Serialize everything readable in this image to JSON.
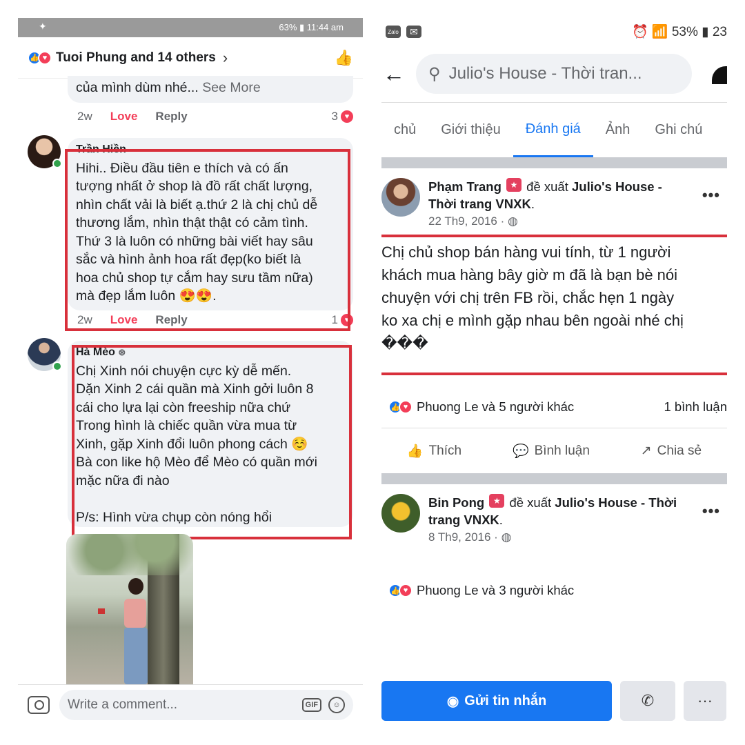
{
  "left": {
    "status": {
      "text": "63% ▮ 11:44 am"
    },
    "header": {
      "title": "Tuoi Phung and 14 others"
    },
    "first_comment": {
      "tail": "của mình dùm nhé...",
      "see_more": "See More",
      "time": "2w",
      "love": "Love",
      "reply": "Reply",
      "count": "3"
    },
    "comment1": {
      "author": "Trần Hiền",
      "lines": [
        "Hihi.. Điều đầu tiên e thích và có ấn",
        "tượng nhất  ở shop là đồ rất  chất lượng,",
        "nhìn chất vải là biết  ạ.thứ  2 là chị chủ dễ",
        "thương lắm, nhìn  thật thật có cảm tình.",
        "Thứ  3 là luôn có những  bài viết hay sâu",
        "sắc và hình ảnh hoa rất đẹp(ko biết  là",
        "hoa chủ shop tự cắm hay sưu tầm nữa)",
        "mà đẹp lắm  luôn 😍😍."
      ],
      "time": "2w",
      "love": "Love",
      "reply": "Reply",
      "count": "1"
    },
    "comment2": {
      "author": "Hà Mèo",
      "lines": [
        "Chị Xinh nói chuyện cực kỳ dễ mến.",
        "Dặn Xinh 2 cái quần mà Xinh gởi luôn 8",
        "cái cho lựa lại còn freeship nữa chứ",
        "Trong hình là chiếc quần vừa mua từ",
        "Xinh, gặp Xinh đổi luôn phong cách ☺️",
        "Bà con like hộ Mèo để Mèo có quần mới",
        "mặc nữa đi nào",
        "",
        "P/s: Hình vừa chụp còn nóng hổi"
      ]
    },
    "comment_input": {
      "placeholder": "Write a comment...",
      "gif": "GIF"
    }
  },
  "right": {
    "status": {
      "text": "⏰ 📶 53% ▮ 23"
    },
    "search": {
      "query": "Julio's House - Thời tran..."
    },
    "tabs": [
      "chủ",
      "Giới thiệu",
      "Đánh giá",
      "Ảnh",
      "Ghi chú"
    ],
    "active_tab": 2,
    "post1": {
      "author": "Phạm Trang",
      "verb": "đề xuất",
      "page": "Julio's House - Thời trang VNXK",
      "date": "22 Th9, 2016 ·",
      "review_lines": [
        "Chị chủ shop bán hàng vui tính, từ 1 người",
        "khách mua hàng bây giờ m đã là bạn bè nói",
        "chuyện với chị trên FB rồi, chắc hẹn 1 ngày",
        "ko xa chị e mình gặp nhau bên ngoài nhé chị",
        "���"
      ],
      "reactions": "Phuong Le và 5 người khác",
      "comments": "1 bình luận"
    },
    "actions": {
      "like": "Thích",
      "comment": "Bình luận",
      "share": "Chia sẻ"
    },
    "post2": {
      "author": "Bin Pong",
      "verb": "đề xuất",
      "page": "Julio's House - Thời trang VNXK",
      "date": "8 Th9, 2016 ·",
      "reactions": "Phuong Le và 3 người khác"
    },
    "bottom": {
      "message": "Gửi tin nhắn",
      "more": "···"
    }
  }
}
